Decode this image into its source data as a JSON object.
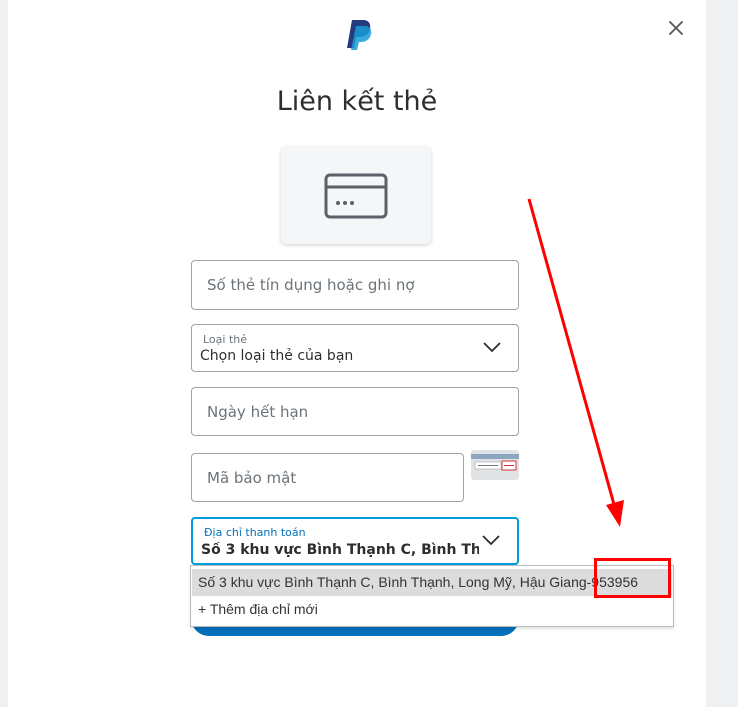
{
  "dialog": {
    "title": "Liên kết thẻ",
    "close_icon": "close-icon",
    "logo_icon": "paypal-logo"
  },
  "form": {
    "card_number": {
      "placeholder": "Số thẻ tín dụng hoặc ghi nợ"
    },
    "card_type": {
      "label": "Loại thẻ",
      "value": "Chọn loại thẻ của bạn"
    },
    "expiry": {
      "placeholder": "Ngày hết hạn"
    },
    "security_code": {
      "placeholder": "Mã bảo mật"
    },
    "billing_address": {
      "label": "Địa chỉ thanh toán",
      "value": "Số 3 khu vực Bình Thạnh C, Bình Thạnh, Long Mỹ, Hậu Giang-953956"
    }
  },
  "dropdown": {
    "options": [
      "Số 3 khu vực Bình Thạnh C, Bình Thạnh, Long Mỹ, Hậu Giang-953956",
      "+ Thêm địa chỉ mới"
    ]
  },
  "colors": {
    "accent": "#0070ba",
    "focus_border": "#009cde",
    "annotation": "#ff0000"
  }
}
